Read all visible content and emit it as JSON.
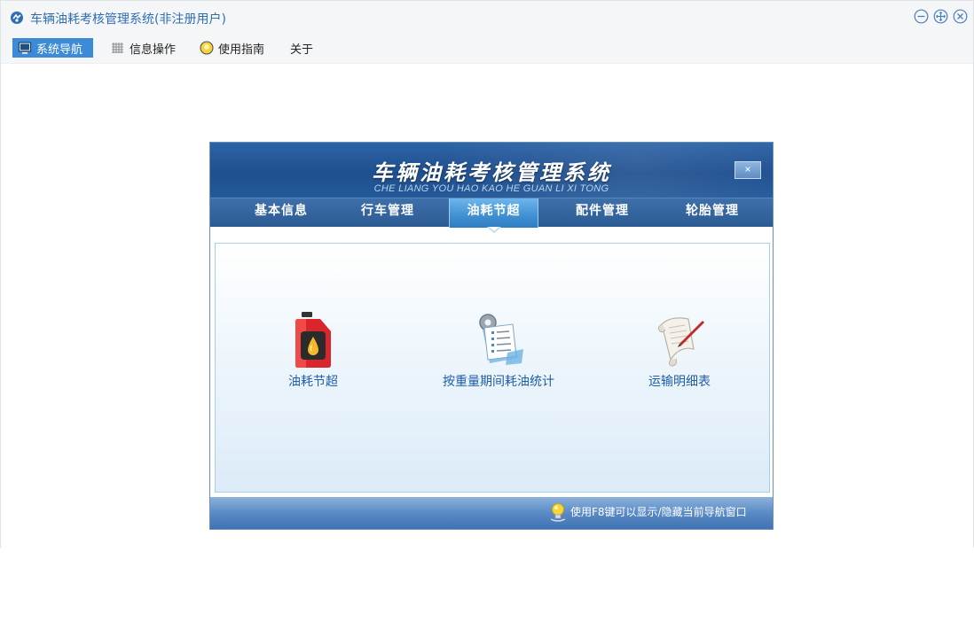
{
  "window": {
    "title": "车辆油耗考核管理系统(非注册用户)",
    "controls": [
      "minimize-icon",
      "maximize-icon",
      "close-icon"
    ]
  },
  "menu": {
    "items": [
      {
        "label": "系统导航",
        "icon": "monitor-icon",
        "active": true
      },
      {
        "label": "信息操作",
        "icon": "grid-icon",
        "active": false
      },
      {
        "label": "使用指南",
        "icon": "bulb-icon",
        "active": false
      },
      {
        "label": "关于",
        "icon": "",
        "active": false
      }
    ]
  },
  "panel": {
    "title": "车辆油耗考核管理系统",
    "subtitle": "CHE LIANG YOU HAO KAO HE  GUAN  LI XI TONG",
    "close_label": "×",
    "tabs": [
      {
        "label": "基本信息",
        "active": false
      },
      {
        "label": "行车管理",
        "active": false
      },
      {
        "label": "油耗节超",
        "active": true
      },
      {
        "label": "配件管理",
        "active": false
      },
      {
        "label": "轮胎管理",
        "active": false
      }
    ],
    "items": [
      {
        "label": "油耗节超",
        "icon": "fuel-can-icon"
      },
      {
        "label": "按重量期间耗油统计",
        "icon": "checklist-gear-icon"
      },
      {
        "label": "运输明细表",
        "icon": "scroll-pen-icon"
      }
    ],
    "footer_hint": "使用F8键可以显示/隐藏当前导航窗口"
  },
  "colors": {
    "accent": "#3d8bd6",
    "title_text": "#2f6eb5",
    "panel_header": "#1f4f8e",
    "item_label": "#1f5ea8"
  }
}
